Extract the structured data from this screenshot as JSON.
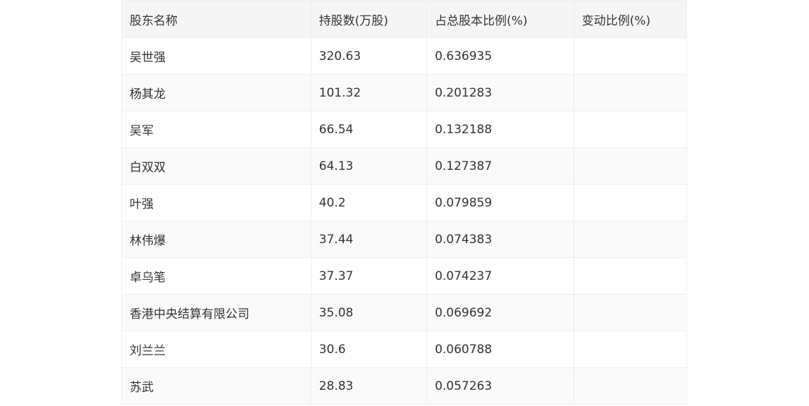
{
  "table": {
    "headers": [
      "股东名称",
      "持股数(万股)",
      "占总股本比例(%)",
      "变动比例(%)"
    ],
    "rows": [
      [
        "吴世强",
        "320.63",
        "0.636935",
        ""
      ],
      [
        "杨其龙",
        "101.32",
        "0.201283",
        ""
      ],
      [
        "吴军",
        "66.54",
        "0.132188",
        ""
      ],
      [
        "白双双",
        "64.13",
        "0.127387",
        ""
      ],
      [
        "叶强",
        "40.2",
        "0.079859",
        ""
      ],
      [
        "林伟爆",
        "37.44",
        "0.074383",
        ""
      ],
      [
        "卓乌笔",
        "37.37",
        "0.074237",
        ""
      ],
      [
        "香港中央结算有限公司",
        "35.08",
        "0.069692",
        ""
      ],
      [
        "刘兰兰",
        "30.6",
        "0.060788",
        ""
      ],
      [
        "苏武",
        "28.83",
        "0.057263",
        ""
      ]
    ]
  }
}
